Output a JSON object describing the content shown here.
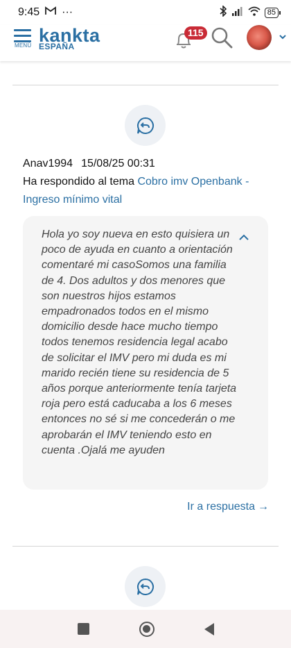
{
  "status_bar": {
    "time": "9:45",
    "mail_icon": "M",
    "more": "···",
    "battery": "85"
  },
  "header": {
    "menu_label": "MENÚ",
    "logo": "kankta",
    "logo_sub": "ESPAÑA",
    "notification_count": "115",
    "icons": [
      "menu-icon",
      "bell-icon",
      "search-icon",
      "avatar",
      "chevron-down-icon"
    ]
  },
  "activity": {
    "username": "Anav1994",
    "datetime": "15/08/25 00:31",
    "action_text": "Ha respondido al tema ",
    "topic_title": "Cobro imv Openbank - Ingreso mínimo vital",
    "quote": "Hola yo soy nueva en esto quisiera un poco de ayuda en cuanto a orientación comentaré mi casoSomos una familia de 4. Dos adultos y dos menores que son nuestros hijos estamos empadronados todos en el mismo domicilio desde hace mucho tiempo todos tenemos residencia legal acabo de solicitar el IMV pero mi duda es mi marido recién tiene su residencia de 5 años porque anteriormente tenía tarjeta roja pero está caducaba a los 6 meses entonces no sé si me concederán o me aprobarán el IMV teniendo esto en cuenta .Ojalá me ayuden",
    "goto_label": "Ir a respuesta",
    "goto_arrow": "→"
  },
  "colors": {
    "accent": "#2a6fa3",
    "badge": "#c92b36",
    "quote_bg": "#f5f5f5"
  }
}
